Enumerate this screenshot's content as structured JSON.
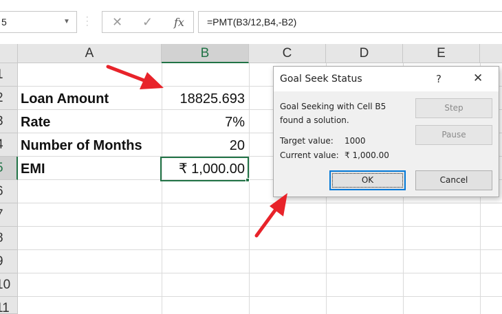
{
  "formula_bar": {
    "name_box": "5",
    "cancel_glyph": "✕",
    "enter_glyph": "✓",
    "fx_label": "fx",
    "formula": "=PMT(B3/12,B4,-B2)"
  },
  "columns": [
    "A",
    "B",
    "C",
    "D",
    "E"
  ],
  "rows": [
    "1",
    "2",
    "3",
    "4",
    "5",
    "6",
    "7",
    "8",
    "9",
    "10",
    "11"
  ],
  "cells": {
    "A2": "Loan Amount",
    "B2": "18825.693",
    "A3": "Rate",
    "B3": "7%",
    "A4": "Number of Months",
    "B4": "20",
    "A5": "EMI",
    "B5": "₹ 1,000.00"
  },
  "dialog": {
    "title": "Goal Seek Status",
    "help": "?",
    "close": "✕",
    "message_line1": "Goal Seeking with Cell B5",
    "message_line2": "found a solution.",
    "target_label": "Target value:",
    "target_value": "1000",
    "current_label": "Current value:",
    "current_value": "₹ 1,000.00",
    "step_label": "Step",
    "pause_label": "Pause",
    "ok_label": "OK",
    "cancel_label": "Cancel"
  },
  "colors": {
    "excel_green": "#217346",
    "annotation_red": "#e8232a",
    "focus_blue": "#0078d7"
  }
}
